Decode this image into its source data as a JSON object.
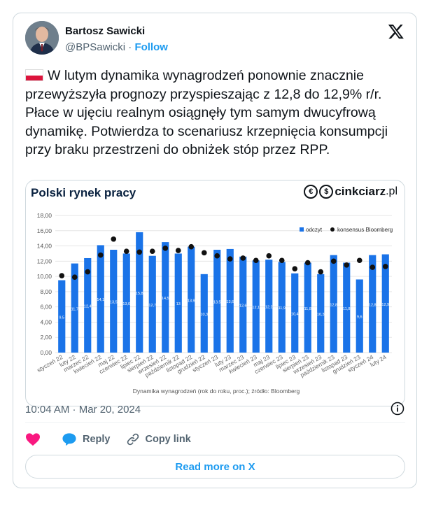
{
  "author": {
    "name": "Bartosz Sawicki",
    "handle": "@BPSawicki",
    "separator": "·",
    "follow_label": "Follow"
  },
  "tweet": {
    "text": "W lutym dynamika wynagrodzeń ponownie znacznie przewyższyła prognozy przyspieszając z 12,8 do 12,9% r/r. Płace w ujęciu realnym osiągnęły tym samym dwucyfrową dynamikę. Potwierdza to scenariusz krzepnięcia konsumpcji przy braku przestrzeni do obniżek stóp przez RPP.",
    "flag_icon": "poland-flag-icon"
  },
  "media": {
    "brand_prefix": "cinkciarz",
    "brand_suffix": ".pl",
    "brand_coin_1": "€",
    "brand_coin_2": "$"
  },
  "timestamp": "10:04 AM · Mar 20, 2024",
  "actions": {
    "like_icon": "heart-icon",
    "reply_label": "Reply",
    "copy_link_label": "Copy link"
  },
  "read_more_label": "Read more on X",
  "colors": {
    "bar": "#1a73e8",
    "dot": "#111111",
    "link": "#1d9bf0",
    "heart": "#f91880"
  },
  "chart_data": {
    "type": "bar",
    "title": "Polski rynek pracy",
    "footnote": "Dynamika wynagrodzeń (rok do roku, proc.); źródło: Bloomberg",
    "categories": [
      "styczeń 22",
      "luty 22",
      "marzec 22",
      "kwiecień 22",
      "maj 22",
      "czerwiec 22",
      "lipiec 22",
      "sierpień 22",
      "wrzesień 22",
      "październik 22",
      "listopad 22",
      "grudzień 22",
      "styczeń 23",
      "luty 23",
      "marzec 23",
      "kwiecień 23",
      "maj 23",
      "czerwiec 23",
      "lipiec 23",
      "sierpień 23",
      "wrzesień 23",
      "październik 23",
      "listopad 23",
      "grudzień 23",
      "styczeń 24",
      "luty 24"
    ],
    "series": [
      {
        "name": "odczyt",
        "kind": "bar",
        "values": [
          9.5,
          11.7,
          12.4,
          14.1,
          13.5,
          13.0,
          15.8,
          12.7,
          14.5,
          13.0,
          13.9,
          10.3,
          13.5,
          13.6,
          12.6,
          12.1,
          12.2,
          11.9,
          10.4,
          11.8,
          10.3,
          12.8,
          11.8,
          9.6,
          12.8,
          12.9
        ]
      },
      {
        "name": "konsensus Bloomberg",
        "kind": "dot",
        "values": [
          10.1,
          9.9,
          10.6,
          12.8,
          14.9,
          13.3,
          13.2,
          13.3,
          13.7,
          13.4,
          13.9,
          13.1,
          12.7,
          12.3,
          12.4,
          12.1,
          12.7,
          12.1,
          11.0,
          11.8,
          10.6,
          12.0,
          11.5,
          12.1,
          11.2,
          11.3
        ]
      }
    ],
    "bar_labels": [
      "9,5",
      "11,7",
      "12,4",
      "14,1",
      "13,5",
      "13,0",
      "15,8",
      "12,7",
      "14,5",
      "13",
      "13,9",
      "10,3",
      "13,5",
      "13,6",
      "12,6",
      "12,1",
      "12,2",
      "11,9",
      "10,4",
      "11,8",
      "10,3",
      "12,8",
      "11,8",
      "9,6",
      "12,8",
      "12,9"
    ],
    "y_ticks": [
      "0,00",
      "2,00",
      "4,00",
      "6,00",
      "8,00",
      "10,00",
      "12,00",
      "14,00",
      "16,00",
      "18,00"
    ],
    "ylim": [
      0,
      18
    ],
    "grid": true,
    "legend_position": "top-right"
  }
}
